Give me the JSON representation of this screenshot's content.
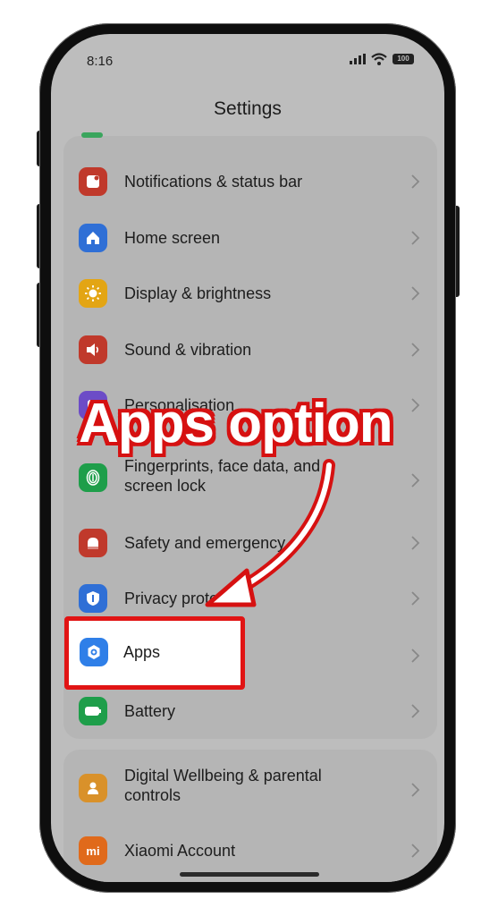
{
  "status_bar": {
    "time": "8:16",
    "battery": "100"
  },
  "page": {
    "title": "Settings"
  },
  "settings_group_1": [
    {
      "label": "Notifications & status bar",
      "icon": "notification-icon",
      "color": "#c0392b"
    },
    {
      "label": "Home screen",
      "icon": "home-icon",
      "color": "#2f6fd6"
    },
    {
      "label": "Display & brightness",
      "icon": "sun-icon",
      "color": "#e3a514"
    },
    {
      "label": "Sound & vibration",
      "icon": "speaker-icon",
      "color": "#c0392b"
    },
    {
      "label": "Personalisation",
      "icon": "palette-icon",
      "color": "#6c4cc7"
    },
    {
      "label": "Fingerprints, face data, and screen lock",
      "icon": "fingerprint-icon",
      "color": "#1e9e4a"
    },
    {
      "label": "Safety and emergency",
      "icon": "emergency-icon",
      "color": "#c0392b"
    },
    {
      "label": "Privacy protection",
      "icon": "shield-icon",
      "color": "#2f6fd6"
    },
    {
      "label": "Apps",
      "icon": "apps-gear-icon",
      "color": "#2f7fe8"
    },
    {
      "label": "Battery",
      "icon": "battery-icon",
      "color": "#1e9e4a"
    }
  ],
  "settings_group_2": [
    {
      "label": "Digital Wellbeing & parental controls",
      "icon": "wellbeing-icon",
      "color": "#d9912a"
    },
    {
      "label": "Xiaomi Account",
      "icon": "xiaomi-icon",
      "color": "#e06a1b"
    }
  ],
  "annotation": {
    "text": "Apps option",
    "color": "#d61111"
  }
}
